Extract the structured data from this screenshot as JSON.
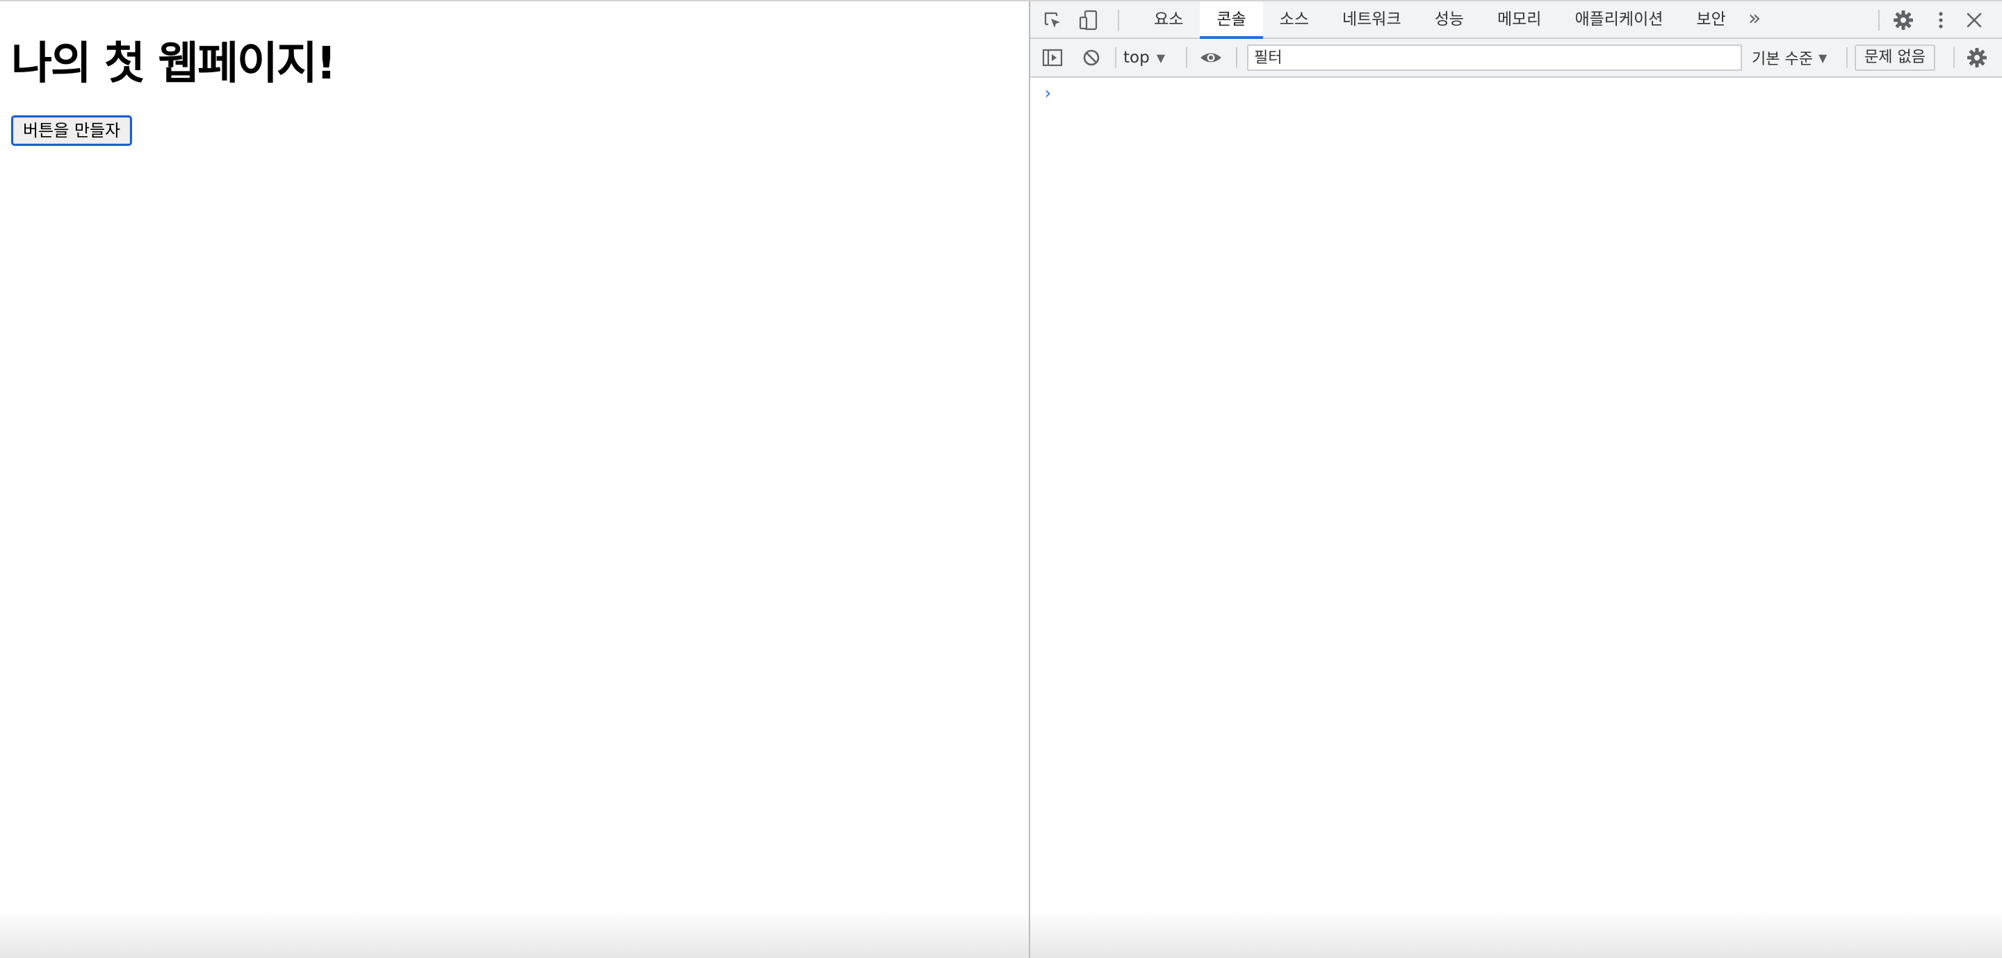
{
  "page": {
    "heading": "나의 첫 웹페이지!",
    "button_label": "버튼을 만들자"
  },
  "devtools": {
    "tabs": [
      {
        "label": "요소",
        "active": false
      },
      {
        "label": "콘솔",
        "active": true
      },
      {
        "label": "소스",
        "active": false
      },
      {
        "label": "네트워크",
        "active": false
      },
      {
        "label": "성능",
        "active": false
      },
      {
        "label": "메모리",
        "active": false
      },
      {
        "label": "애플리케이션",
        "active": false
      },
      {
        "label": "보안",
        "active": false
      }
    ],
    "more_tabs": "»",
    "icons": {
      "inspect": "inspect-element-icon",
      "device": "device-toolbar-icon",
      "settings": "gear-icon",
      "menu": "kebab-menu-icon",
      "close": "close-icon",
      "sidebar": "sidebar-toggle-icon",
      "clear": "clear-console-icon",
      "eye": "live-expression-eye-icon",
      "console_settings": "console-settings-gear-icon"
    },
    "console_toolbar": {
      "context": "top",
      "filter_placeholder": "필터",
      "levels": "기본 수준",
      "issues": "문제 없음"
    },
    "console": {
      "prompt": "›"
    }
  },
  "colors": {
    "accent": "#1a73e8",
    "button_focus_border": "#1a5fd1",
    "toolbar_bg": "#f1f3f4",
    "icon": "#5f6368"
  }
}
